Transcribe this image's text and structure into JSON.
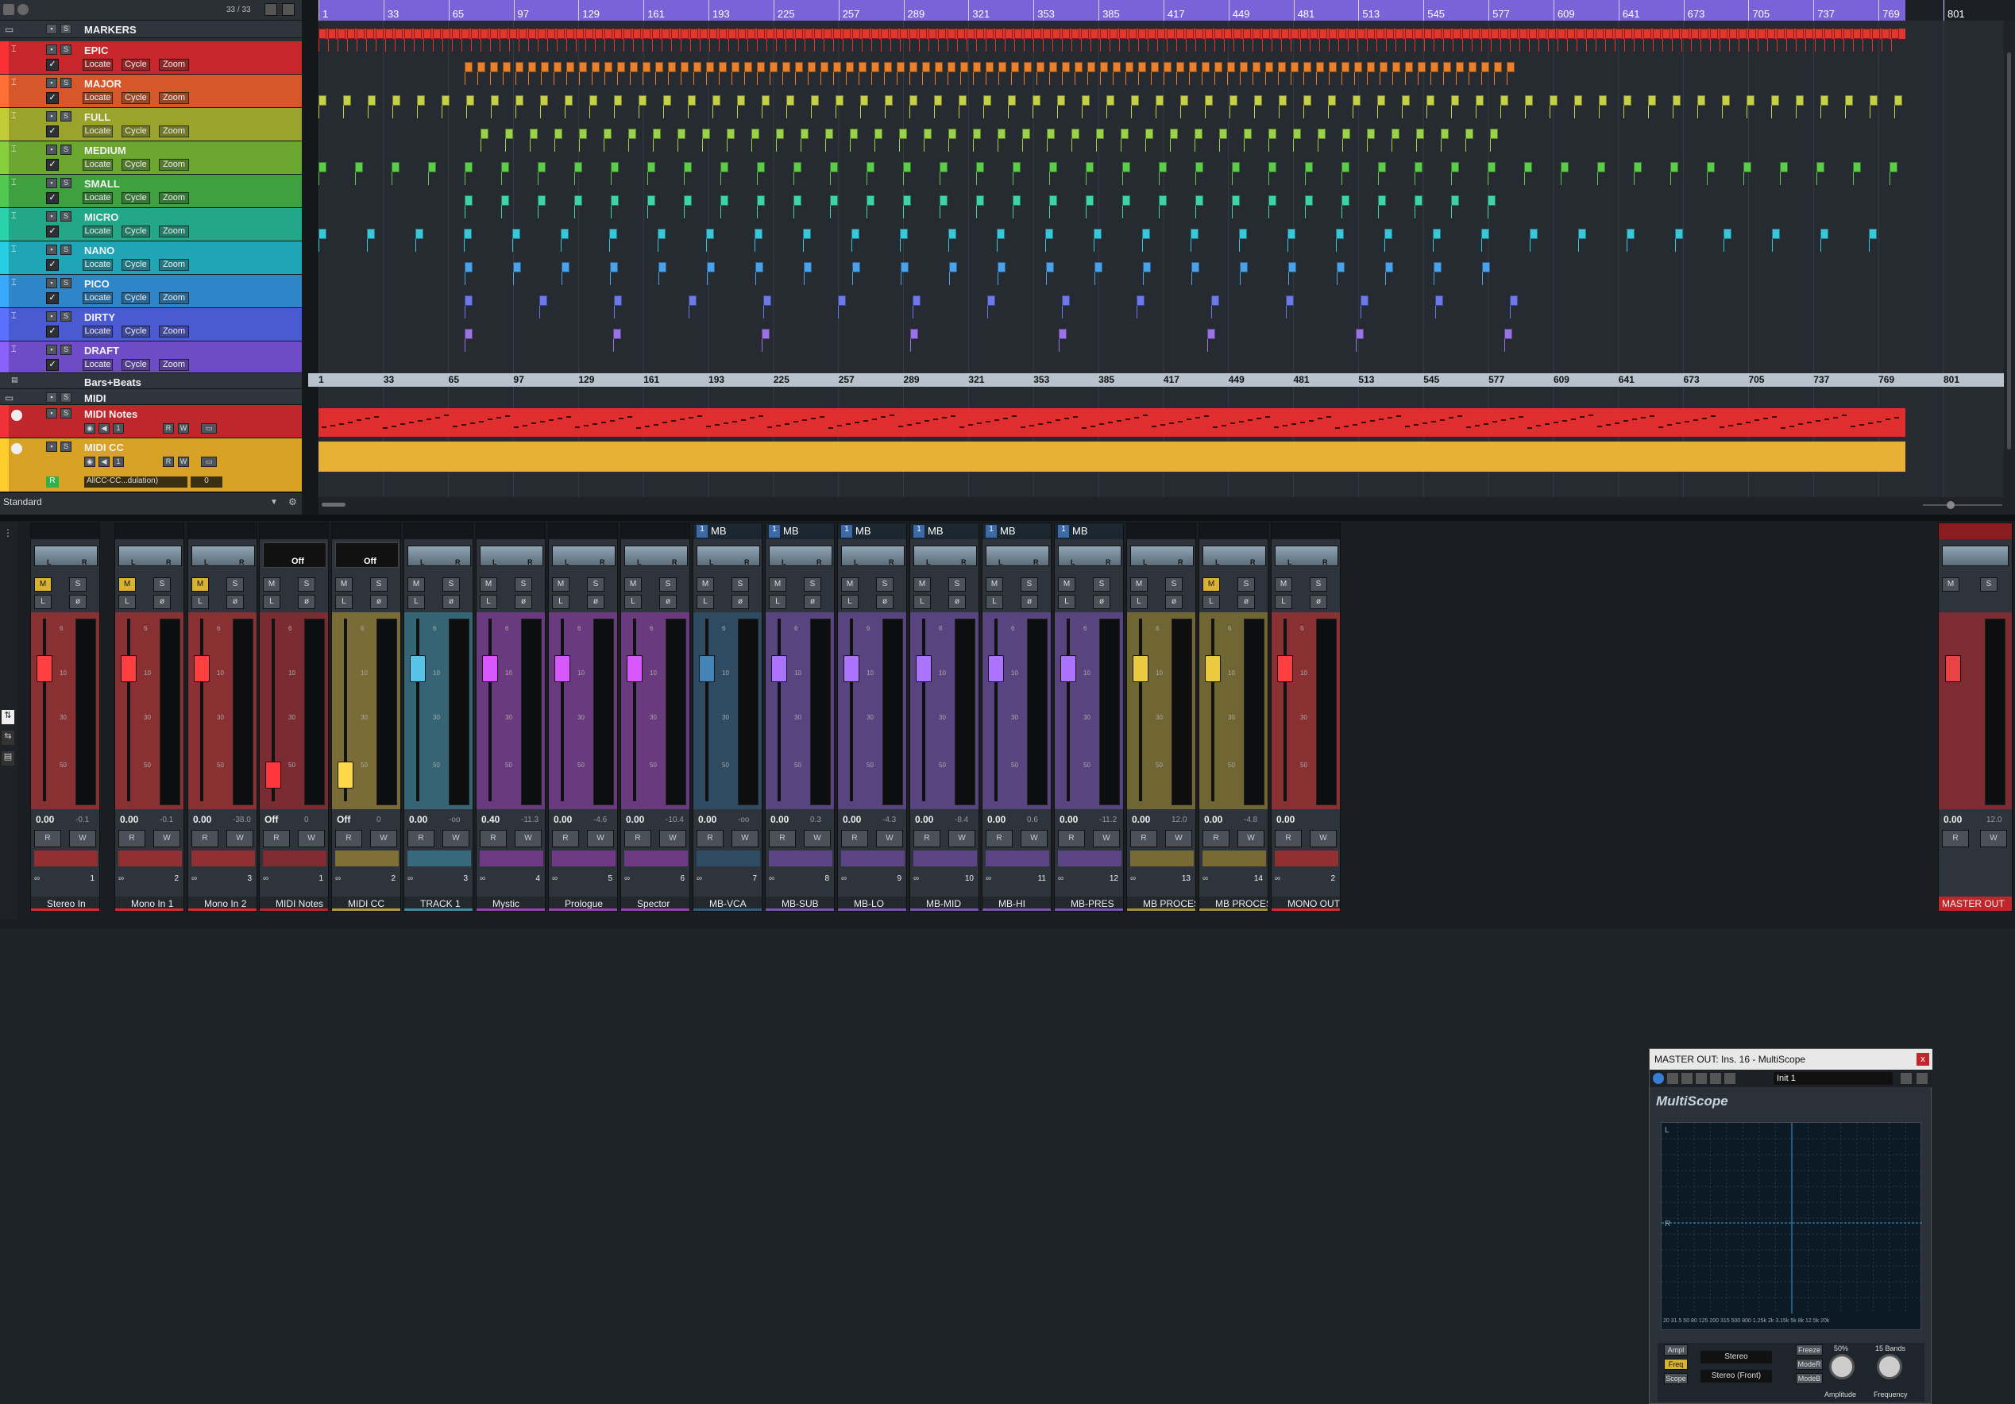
{
  "arrange": {
    "header_counter": "33 / 33",
    "ruler_ticks": [
      "1",
      "33",
      "65",
      "97",
      "129",
      "161",
      "193",
      "225",
      "257",
      "289",
      "321",
      "353",
      "385",
      "417",
      "449",
      "481",
      "513",
      "545",
      "577",
      "609",
      "641",
      "673",
      "705",
      "737",
      "769",
      "801"
    ],
    "tracks": [
      {
        "name": "MARKERS",
        "type": "folder"
      },
      {
        "name": "EPIC",
        "color": "#c7272a"
      },
      {
        "name": "MAJOR",
        "color": "#d6582a"
      },
      {
        "name": "FULL",
        "color": "#9aa42c"
      },
      {
        "name": "MEDIUM",
        "color": "#6aa630"
      },
      {
        "name": "SMALL",
        "color": "#3fa040"
      },
      {
        "name": "MICRO",
        "color": "#22a889"
      },
      {
        "name": "NANO",
        "color": "#1fa5b5"
      },
      {
        "name": "PICO",
        "color": "#2e86c8"
      },
      {
        "name": "DIRTY",
        "color": "#4a5ad0"
      },
      {
        "name": "DRAFT",
        "color": "#6e4cc8"
      },
      {
        "name": "Bars+Beats",
        "type": "ruler"
      },
      {
        "name": "MIDI",
        "type": "folder"
      },
      {
        "name": "MIDI Notes",
        "color": "#c0272d"
      },
      {
        "name": "MIDI CC",
        "color": "#d8a325"
      }
    ],
    "marker_buttons": {
      "locate": "Locate",
      "cycle": "Cycle",
      "zoom": "Zoom"
    },
    "cc_lane_label": "AllCC-CC...dulation)",
    "cc_value": "0",
    "footer_label": "Standard"
  },
  "mixer": {
    "channels": [
      {
        "name": "Stereo In",
        "num": "1",
        "vol": "0.00",
        "peak": "-0.1",
        "color": "#d62d2d"
      },
      {
        "name": "Mono In 1",
        "num": "2",
        "vol": "0.00",
        "peak": "-0.1",
        "color": "#d62d2d"
      },
      {
        "name": "Mono In 2",
        "num": "3",
        "vol": "0.00",
        "peak": "-38.0",
        "color": "#d62d2d"
      },
      {
        "name": "MIDI Notes",
        "num": "1",
        "vol": "Off",
        "peak": "0",
        "color": "#b9272b",
        "off": "Off"
      },
      {
        "name": "MIDI CC",
        "num": "2",
        "vol": "Off",
        "peak": "0",
        "color": "#b89a35",
        "off": "Off"
      },
      {
        "name": "TRACK 1",
        "num": "3",
        "vol": "0.00",
        "peak": "-oo",
        "color": "#3d8ca6"
      },
      {
        "name": "Mystic",
        "num": "4",
        "vol": "0.40",
        "peak": "-11.3",
        "color": "#9a3fb5"
      },
      {
        "name": "Prologue",
        "num": "5",
        "vol": "0.00",
        "peak": "-4.6",
        "color": "#9a3fb5"
      },
      {
        "name": "Spector",
        "num": "6",
        "vol": "0.00",
        "peak": "-10.4",
        "color": "#9a3fb5"
      },
      {
        "name": "MB-VCA",
        "num": "7",
        "vol": "0.00",
        "peak": "-oo",
        "color": "#2f5f82",
        "mb": "MB"
      },
      {
        "name": "MB-SUB",
        "num": "8",
        "vol": "0.00",
        "peak": "0.3",
        "color": "#7b52b6",
        "mb": "MB"
      },
      {
        "name": "MB-LO",
        "num": "9",
        "vol": "0.00",
        "peak": "-4.3",
        "color": "#7b52b6",
        "mb": "MB"
      },
      {
        "name": "MB-MID",
        "num": "10",
        "vol": "0.00",
        "peak": "-8.4",
        "color": "#7b52b6",
        "mb": "MB"
      },
      {
        "name": "MB-HI",
        "num": "11",
        "vol": "0.00",
        "peak": "0.6",
        "color": "#7b52b6",
        "mb": "MB"
      },
      {
        "name": "MB-PRES",
        "num": "12",
        "vol": "0.00",
        "peak": "-11.2",
        "color": "#7b52b6",
        "mb": "MB"
      },
      {
        "name": "MB PROCESSIN",
        "num": "13",
        "vol": "0.00",
        "peak": "12.0",
        "color": "#a8902f"
      },
      {
        "name": "MB PROCESSIN",
        "num": "14",
        "vol": "0.00",
        "peak": "-4.8",
        "color": "#a8902f"
      },
      {
        "name": "MONO OUT",
        "num": "2",
        "vol": "0.00",
        "peak": "",
        "color": "#d62d2d"
      }
    ],
    "master": {
      "name": "MASTER OUT",
      "vol": "0.00",
      "peak": "12.0"
    },
    "strip_buttons": {
      "m": "M",
      "s": "S",
      "l": "L",
      "r": "R",
      "w": "W"
    }
  },
  "multiscope": {
    "title": "MASTER OUT: Ins. 16 - MultiScope",
    "preset": "Init 1",
    "logo": "MultiScope",
    "channel_labels": {
      "left": "L",
      "right": "R"
    },
    "freq_axis": "20  31.5  50  80  125  200  315  500  800  1.25k  2k  3.15k  5k  8k  12.5k  20k",
    "buttons": {
      "ampl": "Ampl",
      "freq": "Freq",
      "scope": "Scope",
      "freeze": "Freeze",
      "mode1": "ModeR",
      "mode2": "ModeB"
    },
    "mode_select": "Stereo",
    "mode_select2": "Stereo (Front)",
    "knob1": {
      "label": "Amplitude",
      "value": "50%"
    },
    "knob2": {
      "label": "Frequency",
      "value": "15 Bands"
    }
  }
}
